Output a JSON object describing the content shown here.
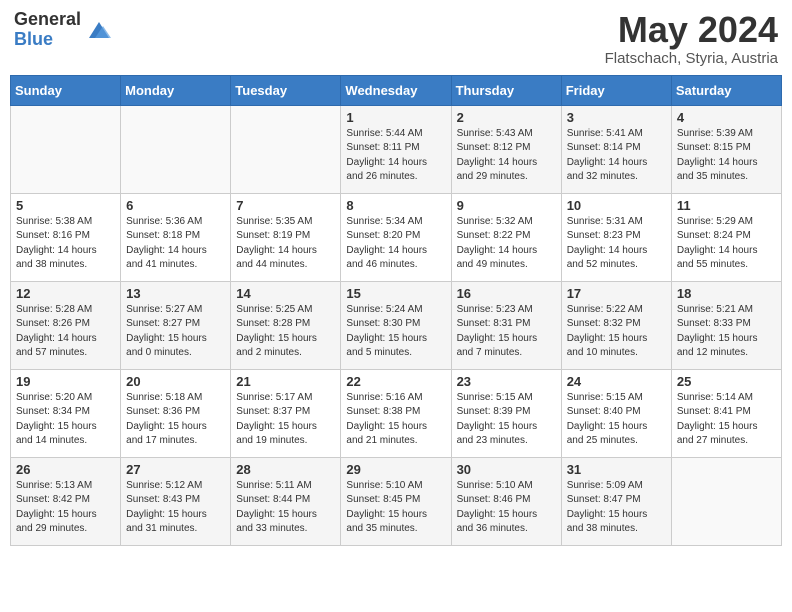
{
  "header": {
    "logo_general": "General",
    "logo_blue": "Blue",
    "month_year": "May 2024",
    "location": "Flatschach, Styria, Austria"
  },
  "days_of_week": [
    "Sunday",
    "Monday",
    "Tuesday",
    "Wednesday",
    "Thursday",
    "Friday",
    "Saturday"
  ],
  "weeks": [
    [
      {
        "num": "",
        "info": ""
      },
      {
        "num": "",
        "info": ""
      },
      {
        "num": "",
        "info": ""
      },
      {
        "num": "1",
        "info": "Sunrise: 5:44 AM\nSunset: 8:11 PM\nDaylight: 14 hours\nand 26 minutes."
      },
      {
        "num": "2",
        "info": "Sunrise: 5:43 AM\nSunset: 8:12 PM\nDaylight: 14 hours\nand 29 minutes."
      },
      {
        "num": "3",
        "info": "Sunrise: 5:41 AM\nSunset: 8:14 PM\nDaylight: 14 hours\nand 32 minutes."
      },
      {
        "num": "4",
        "info": "Sunrise: 5:39 AM\nSunset: 8:15 PM\nDaylight: 14 hours\nand 35 minutes."
      }
    ],
    [
      {
        "num": "5",
        "info": "Sunrise: 5:38 AM\nSunset: 8:16 PM\nDaylight: 14 hours\nand 38 minutes."
      },
      {
        "num": "6",
        "info": "Sunrise: 5:36 AM\nSunset: 8:18 PM\nDaylight: 14 hours\nand 41 minutes."
      },
      {
        "num": "7",
        "info": "Sunrise: 5:35 AM\nSunset: 8:19 PM\nDaylight: 14 hours\nand 44 minutes."
      },
      {
        "num": "8",
        "info": "Sunrise: 5:34 AM\nSunset: 8:20 PM\nDaylight: 14 hours\nand 46 minutes."
      },
      {
        "num": "9",
        "info": "Sunrise: 5:32 AM\nSunset: 8:22 PM\nDaylight: 14 hours\nand 49 minutes."
      },
      {
        "num": "10",
        "info": "Sunrise: 5:31 AM\nSunset: 8:23 PM\nDaylight: 14 hours\nand 52 minutes."
      },
      {
        "num": "11",
        "info": "Sunrise: 5:29 AM\nSunset: 8:24 PM\nDaylight: 14 hours\nand 55 minutes."
      }
    ],
    [
      {
        "num": "12",
        "info": "Sunrise: 5:28 AM\nSunset: 8:26 PM\nDaylight: 14 hours\nand 57 minutes."
      },
      {
        "num": "13",
        "info": "Sunrise: 5:27 AM\nSunset: 8:27 PM\nDaylight: 15 hours\nand 0 minutes."
      },
      {
        "num": "14",
        "info": "Sunrise: 5:25 AM\nSunset: 8:28 PM\nDaylight: 15 hours\nand 2 minutes."
      },
      {
        "num": "15",
        "info": "Sunrise: 5:24 AM\nSunset: 8:30 PM\nDaylight: 15 hours\nand 5 minutes."
      },
      {
        "num": "16",
        "info": "Sunrise: 5:23 AM\nSunset: 8:31 PM\nDaylight: 15 hours\nand 7 minutes."
      },
      {
        "num": "17",
        "info": "Sunrise: 5:22 AM\nSunset: 8:32 PM\nDaylight: 15 hours\nand 10 minutes."
      },
      {
        "num": "18",
        "info": "Sunrise: 5:21 AM\nSunset: 8:33 PM\nDaylight: 15 hours\nand 12 minutes."
      }
    ],
    [
      {
        "num": "19",
        "info": "Sunrise: 5:20 AM\nSunset: 8:34 PM\nDaylight: 15 hours\nand 14 minutes."
      },
      {
        "num": "20",
        "info": "Sunrise: 5:18 AM\nSunset: 8:36 PM\nDaylight: 15 hours\nand 17 minutes."
      },
      {
        "num": "21",
        "info": "Sunrise: 5:17 AM\nSunset: 8:37 PM\nDaylight: 15 hours\nand 19 minutes."
      },
      {
        "num": "22",
        "info": "Sunrise: 5:16 AM\nSunset: 8:38 PM\nDaylight: 15 hours\nand 21 minutes."
      },
      {
        "num": "23",
        "info": "Sunrise: 5:15 AM\nSunset: 8:39 PM\nDaylight: 15 hours\nand 23 minutes."
      },
      {
        "num": "24",
        "info": "Sunrise: 5:15 AM\nSunset: 8:40 PM\nDaylight: 15 hours\nand 25 minutes."
      },
      {
        "num": "25",
        "info": "Sunrise: 5:14 AM\nSunset: 8:41 PM\nDaylight: 15 hours\nand 27 minutes."
      }
    ],
    [
      {
        "num": "26",
        "info": "Sunrise: 5:13 AM\nSunset: 8:42 PM\nDaylight: 15 hours\nand 29 minutes."
      },
      {
        "num": "27",
        "info": "Sunrise: 5:12 AM\nSunset: 8:43 PM\nDaylight: 15 hours\nand 31 minutes."
      },
      {
        "num": "28",
        "info": "Sunrise: 5:11 AM\nSunset: 8:44 PM\nDaylight: 15 hours\nand 33 minutes."
      },
      {
        "num": "29",
        "info": "Sunrise: 5:10 AM\nSunset: 8:45 PM\nDaylight: 15 hours\nand 35 minutes."
      },
      {
        "num": "30",
        "info": "Sunrise: 5:10 AM\nSunset: 8:46 PM\nDaylight: 15 hours\nand 36 minutes."
      },
      {
        "num": "31",
        "info": "Sunrise: 5:09 AM\nSunset: 8:47 PM\nDaylight: 15 hours\nand 38 minutes."
      },
      {
        "num": "",
        "info": ""
      }
    ]
  ]
}
